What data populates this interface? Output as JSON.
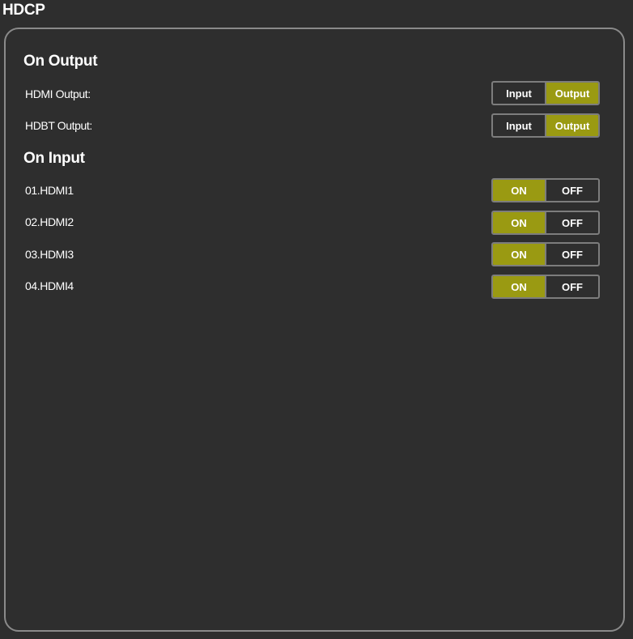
{
  "page": {
    "title": "HDCP"
  },
  "on_output": {
    "title": "On Output",
    "rows": [
      {
        "label": "HDMI Output:",
        "options": [
          "Input",
          "Output"
        ],
        "selected": "Output"
      },
      {
        "label": "HDBT Output:",
        "options": [
          "Input",
          "Output"
        ],
        "selected": "Output"
      }
    ]
  },
  "on_input": {
    "title": "On Input",
    "rows": [
      {
        "label": "01.HDMI1",
        "options": [
          "ON",
          "OFF"
        ],
        "selected": "ON"
      },
      {
        "label": "02.HDMI2",
        "options": [
          "ON",
          "OFF"
        ],
        "selected": "ON"
      },
      {
        "label": "03.HDMI3",
        "options": [
          "ON",
          "OFF"
        ],
        "selected": "ON"
      },
      {
        "label": "04.HDMI4",
        "options": [
          "ON",
          "OFF"
        ],
        "selected": "ON"
      }
    ]
  },
  "colors": {
    "background": "#2e2e2e",
    "active_segment": "#9a9a12",
    "border": "#8a8a8a",
    "text": "#ffffff"
  }
}
